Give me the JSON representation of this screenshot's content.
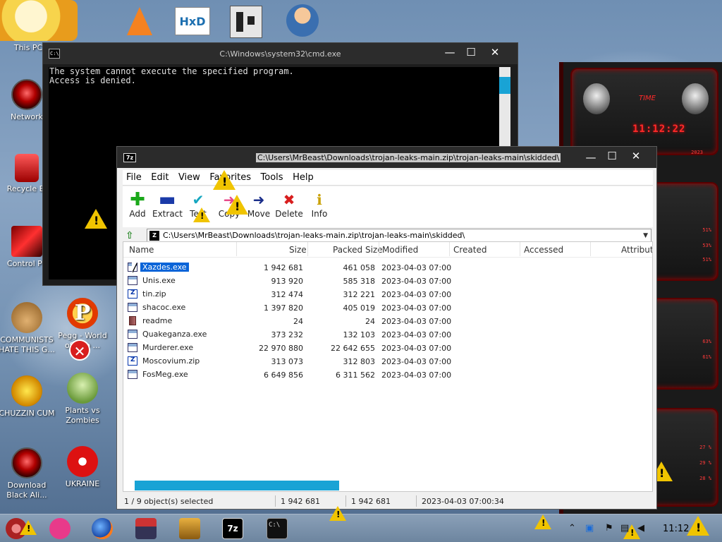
{
  "desktop": {
    "icons": [
      {
        "label": "This PC"
      },
      {
        "label": "Network"
      },
      {
        "label": "Recycle Bi"
      },
      {
        "label": "Control Pa"
      },
      {
        "label": "COMMUNISTS HATE THIS G..."
      },
      {
        "label": "Pegg - World of Goo ..."
      },
      {
        "label": "CHUZZIN CUM"
      },
      {
        "label": "Plants vs Zombies"
      },
      {
        "label": "Download Black Ali..."
      },
      {
        "label": "UKRAINE"
      }
    ],
    "top_shortcuts": [
      "vlc-icon",
      "hxd-icon",
      "app-icon",
      "doctor-icon"
    ],
    "colors": {
      "accent": "#19a3d5",
      "gadget_red": "#ff2a2a",
      "warning": "#f0c400"
    }
  },
  "cmd": {
    "title": "C:\\Windows\\system32\\cmd.exe",
    "icon_text": "C:\\",
    "output": "The system cannot execute the specified program.\nAccess is denied.",
    "buttons": {
      "min": "—",
      "max": "☐",
      "close": "✕"
    }
  },
  "gadget": {
    "label": "TIME",
    "clock": "11:12:22",
    "readouts": [
      "2023",
      "51%",
      "53%",
      "51%",
      "63%",
      "61%",
      "27 %",
      "29 %",
      "28 %"
    ]
  },
  "zip": {
    "icon_text": "7z",
    "title": "C:\\Users\\MrBeast\\Downloads\\trojan-leaks-main.zip\\trojan-leaks-main\\skidded\\",
    "menu": [
      "File",
      "Edit",
      "View",
      "Favorites",
      "Tools",
      "Help"
    ],
    "toolbar": [
      {
        "label": "Add",
        "icon": "add-icon"
      },
      {
        "label": "Extract",
        "icon": "extract-icon"
      },
      {
        "label": "Test",
        "icon": "test-icon"
      },
      {
        "label": "Copy",
        "icon": "copy-icon"
      },
      {
        "label": "Move",
        "icon": "move-icon"
      },
      {
        "label": "Delete",
        "icon": "delete-icon"
      },
      {
        "label": "Info",
        "icon": "info-icon"
      }
    ],
    "address": "C:\\Users\\MrBeast\\Downloads\\trojan-leaks-main.zip\\trojan-leaks-main\\skidded\\",
    "columns": [
      "Name",
      "Size",
      "Packed Size",
      "Modified",
      "Created",
      "Accessed",
      "Attributes"
    ],
    "files": [
      {
        "name": "Xazdes.exe",
        "size": "1 942 681",
        "packed": "461 058",
        "modified": "2023-04-03 07:00",
        "type": "exe"
      },
      {
        "name": "Unis.exe",
        "size": "913 920",
        "packed": "585 318",
        "modified": "2023-04-03 07:00",
        "type": "exe"
      },
      {
        "name": "tin.zip",
        "size": "312 474",
        "packed": "312 221",
        "modified": "2023-04-03 07:00",
        "type": "zip"
      },
      {
        "name": "shacoc.exe",
        "size": "1 397 820",
        "packed": "405 019",
        "modified": "2023-04-03 07:00",
        "type": "exe"
      },
      {
        "name": "readme",
        "size": "24",
        "packed": "24",
        "modified": "2023-04-03 07:00",
        "type": "txt"
      },
      {
        "name": "Quakeganza.exe",
        "size": "373 232",
        "packed": "132 103",
        "modified": "2023-04-03 07:00",
        "type": "exe"
      },
      {
        "name": "Murderer.exe",
        "size": "22 970 880",
        "packed": "22 642 655",
        "modified": "2023-04-03 07:00",
        "type": "exe"
      },
      {
        "name": "Moscovium.zip",
        "size": "313 073",
        "packed": "312 803",
        "modified": "2023-04-03 07:00",
        "type": "zip"
      },
      {
        "name": "FosMeg.exe",
        "size": "6 649 856",
        "packed": "6 311 562",
        "modified": "2023-04-03 07:00",
        "type": "exe"
      }
    ],
    "status": {
      "selected": "1 / 9 object(s) selected",
      "size": "1 942 681",
      "packed": "1 942 681",
      "modified": "2023-04-03 07:00:34"
    }
  },
  "taskbar": {
    "clock": "11:12",
    "apps": [
      "start-orb-icon",
      "notes-icon",
      "firefox-icon",
      "printer-icon",
      "keyboard-icon",
      "7zip-taskbar-icon",
      "cmd-taskbar-icon"
    ],
    "app_7z_text": "7z",
    "app_cmd_text": "C:\\",
    "tray": [
      "chevron-up-icon",
      "bluetooth-icon",
      "flag-icon",
      "network-icon",
      "volume-icon"
    ]
  }
}
